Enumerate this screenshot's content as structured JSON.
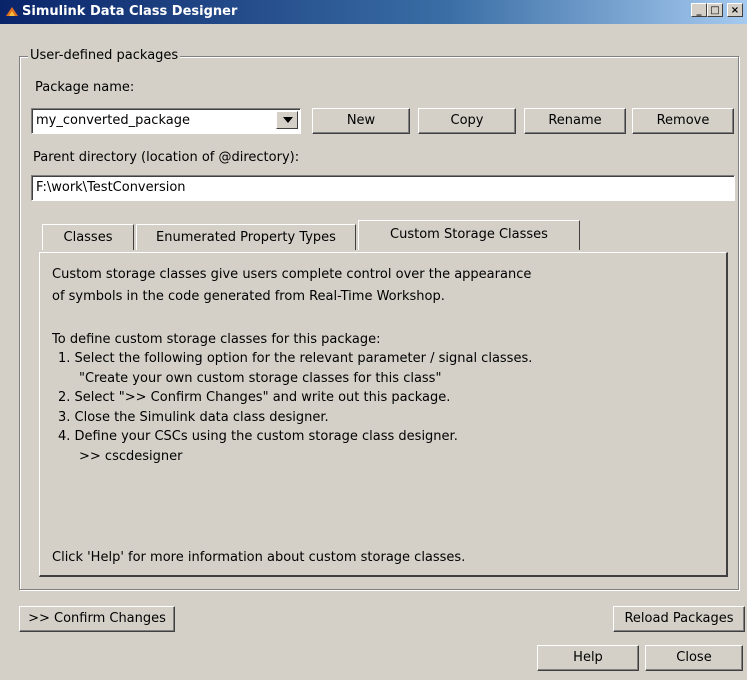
{
  "window": {
    "title": "Simulink Data Class Designer",
    "minimize": "_",
    "maximize": "□",
    "close": "×"
  },
  "group": {
    "legend": "User-defined packages",
    "package_label": "Package name:",
    "package_value": "my_converted_package",
    "buttons": {
      "new": "New",
      "copy": "Copy",
      "rename": "Rename",
      "remove": "Remove"
    },
    "parent_label": "Parent directory (location of @directory):",
    "parent_value": "F:\\work\\TestConversion"
  },
  "tabs": [
    "Classes",
    "Enumerated Property Types",
    "Custom Storage Classes"
  ],
  "panel": {
    "intro1": "Custom storage classes give users complete control over the appearance",
    "intro2": "of symbols in the code generated from Real-Time Workshop.",
    "define": "To define custom storage classes for this package:",
    "step1": "1. Select the following option for the relevant parameter / signal classes.",
    "step1b": "\"Create your own custom storage classes for this class\"",
    "step2": "2. Select \">> Confirm Changes\" and write out this package.",
    "step3": "3. Close the Simulink data class designer.",
    "step4": "4. Define your CSCs using the custom storage class designer.",
    "step4b": ">> cscdesigner",
    "help_note": "Click 'Help' for more information about custom storage classes."
  },
  "footer": {
    "confirm": ">> Confirm Changes",
    "reload": "Reload Packages",
    "help": "Help",
    "close": "Close"
  }
}
